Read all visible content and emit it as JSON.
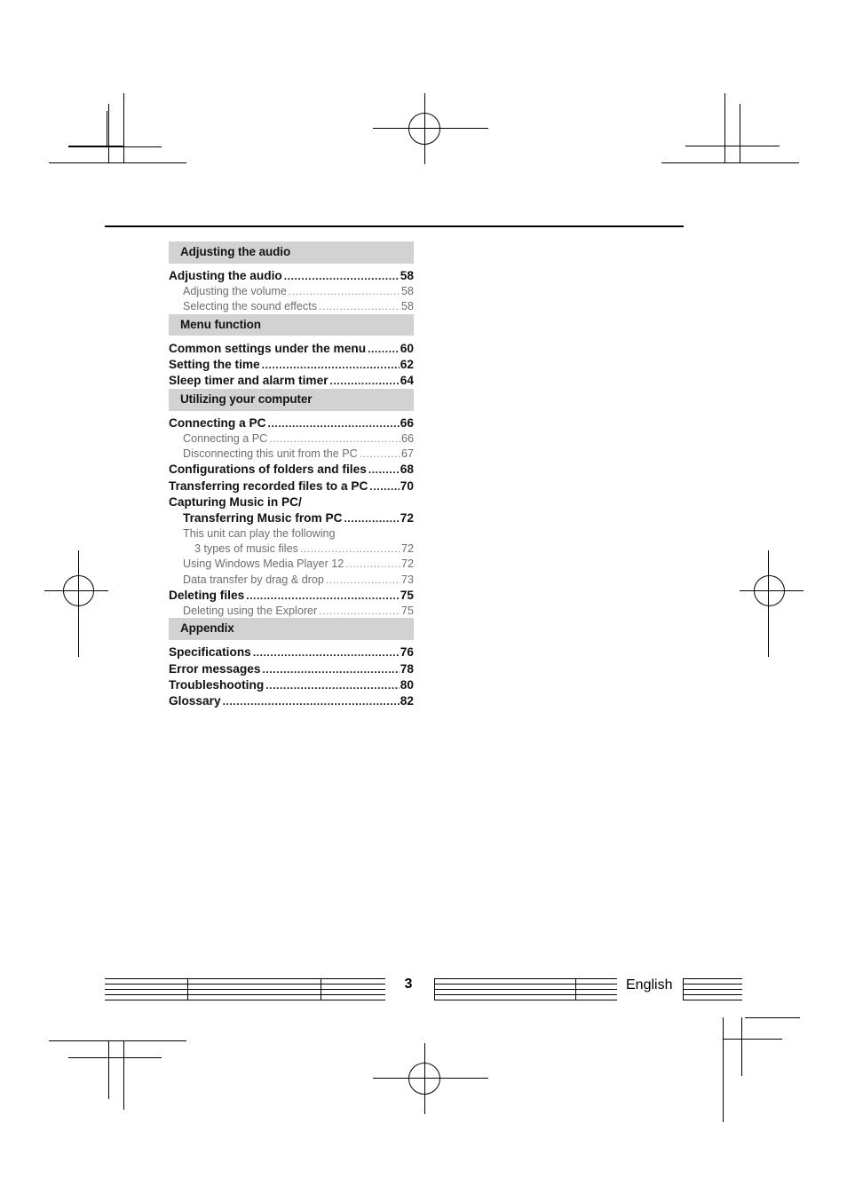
{
  "document": {
    "page_number": "3",
    "language": "English",
    "colors": {
      "section_header_bg": "#d2d2d2",
      "primary_text": "#111111",
      "secondary_text": "#6e6e6e"
    }
  },
  "toc": {
    "sections": [
      {
        "header": "Adjusting the audio",
        "entries": [
          {
            "level": 1,
            "label": "Adjusting the audio",
            "page": "58"
          },
          {
            "level": 2,
            "label": "Adjusting the volume",
            "page": "58"
          },
          {
            "level": 2,
            "label": "Selecting the sound effects",
            "page": "58"
          }
        ]
      },
      {
        "header": "Menu function",
        "entries": [
          {
            "level": 1,
            "label": "Common settings under the menu",
            "page": "60"
          },
          {
            "level": 1,
            "label": "Setting the time",
            "page": "62"
          },
          {
            "level": 1,
            "label": "Sleep timer and alarm timer",
            "page": "64"
          }
        ]
      },
      {
        "header": "Utilizing your computer",
        "entries": [
          {
            "level": 1,
            "label": "Connecting a PC",
            "page": "66"
          },
          {
            "level": 2,
            "label": "Connecting a PC",
            "page": "66"
          },
          {
            "level": 2,
            "label": "Disconnecting this unit from the PC",
            "page": "67"
          },
          {
            "level": 1,
            "label": "Configurations of folders and files",
            "page": "68"
          },
          {
            "level": 1,
            "label": "Transferring recorded files to a PC",
            "page": "70"
          },
          {
            "level": 1,
            "label": "Capturing Music in PC/",
            "page": "",
            "noleader": true
          },
          {
            "level": "1b",
            "label": "Transferring Music from PC",
            "page": "72"
          },
          {
            "level": 2,
            "label": "This unit can play the following",
            "page": "",
            "noleader": true
          },
          {
            "level": 3,
            "label": "3 types of music files",
            "page": "72"
          },
          {
            "level": 2,
            "label": "Using Windows Media Player 12",
            "page": "72"
          },
          {
            "level": 2,
            "label": "Data transfer by drag & drop",
            "page": "73"
          },
          {
            "level": 1,
            "label": "Deleting files",
            "page": "75"
          },
          {
            "level": 2,
            "label": "Deleting using the Explorer",
            "page": "75"
          }
        ]
      },
      {
        "header": "Appendix",
        "entries": [
          {
            "level": 1,
            "label": "Specifications",
            "page": "76"
          },
          {
            "level": 1,
            "label": "Error messages",
            "page": "78"
          },
          {
            "level": 1,
            "label": "Troubleshooting",
            "page": "80"
          },
          {
            "level": 1,
            "label": "Glossary",
            "page": "82"
          }
        ]
      }
    ]
  }
}
